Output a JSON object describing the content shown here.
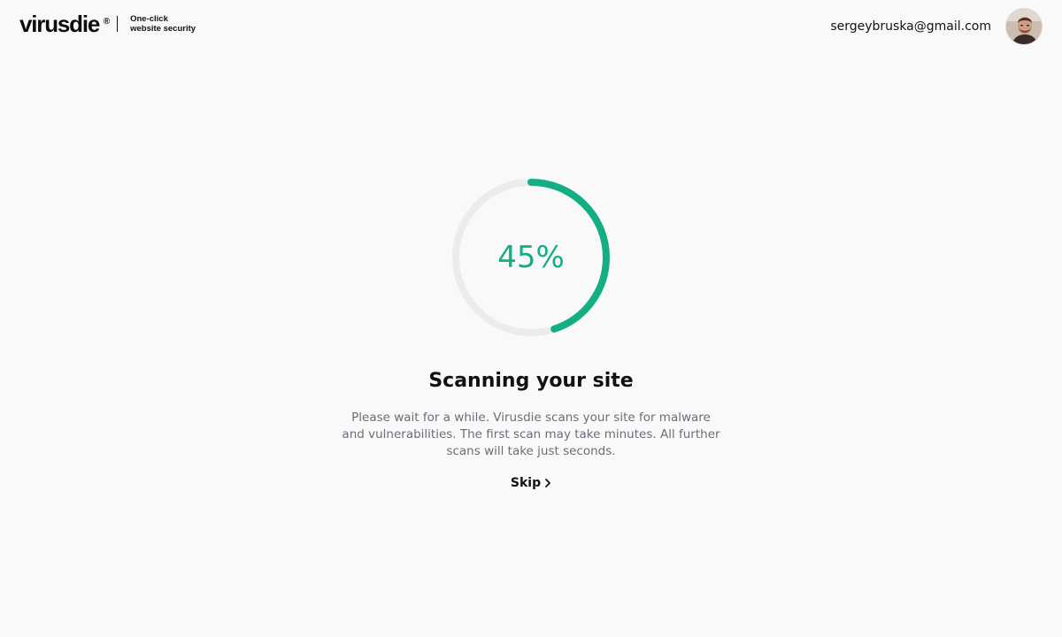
{
  "header": {
    "logo_text": "virusdie",
    "logo_mark": "®",
    "tagline_line1": "One-click",
    "tagline_line2": "website security",
    "user_email": "sergeybruska@gmail.com",
    "avatar_icon": "user-avatar"
  },
  "scan": {
    "progress": 0.45,
    "progress_label": "45%",
    "title": "Scanning your site",
    "description": "Please wait for a while. Virusdie scans your site for malware and vulnerabilities. The first scan may take minutes. All further scans will take just seconds.",
    "skip_label": "Skip",
    "skip_icon": "chevron-right-icon"
  },
  "colors": {
    "accent": "#14ae84",
    "track": "#ececec",
    "background": "#f9f9f9",
    "muted_text": "#6a6e77"
  }
}
